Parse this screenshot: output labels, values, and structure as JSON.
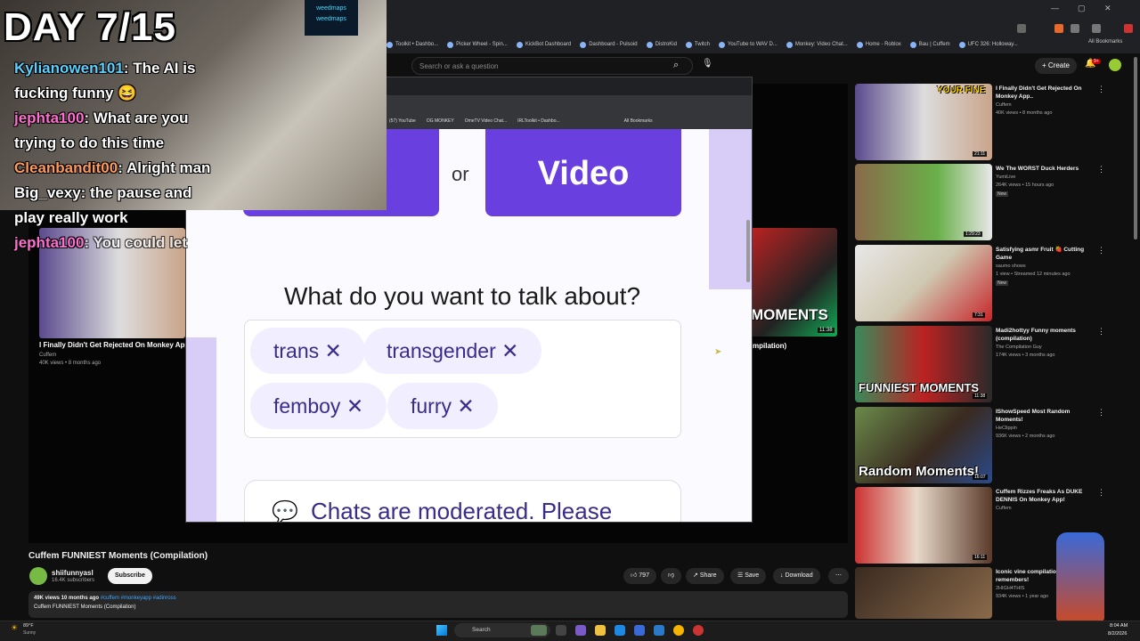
{
  "outer_browser": {
    "bookmarks": [
      "Toolkit • Dashbo...",
      "Picker Wheel - Spin...",
      "KickBot Dashboard",
      "Dashboard - Pulsoid",
      "DistroKid",
      "Twitch",
      "YouTube to WAV D...",
      "Monkey: Video Chat...",
      "Home - Roblox",
      "Bau | Cuffem",
      "UFC 326: Holloway..."
    ],
    "all_bookmarks": "All Bookmarks",
    "youtube": {
      "search_placeholder": "Search or ask a question",
      "create_label": "Create",
      "bell_badge": "9+"
    }
  },
  "overlay": {
    "day_label": "DAY 7/15",
    "neon_sign": "weedmaps",
    "chat": [
      {
        "user": "Kylianowen101",
        "message": ": The AI is"
      },
      {
        "user": "",
        "message": "fucking funny 😆"
      },
      {
        "user": "jephta100",
        "message": ": What are you"
      },
      {
        "user": "",
        "message": "trying to do this time"
      },
      {
        "user": "Cleanbandit00",
        "message": ": Alright man"
      },
      {
        "user": "",
        "message": "Big_vexy: the pause and"
      },
      {
        "user": "",
        "message": "play really work"
      },
      {
        "user": "jephta100",
        "message": ": You could let"
      }
    ]
  },
  "inner_browser": {
    "bookmarks": [
      "(57) YouTube",
      "OG MONKEY",
      "OmeTV Video Chat...",
      "IRLToolkit • Dashbo..."
    ],
    "all_bookmarks": "All Bookmarks",
    "page": {
      "or_label": "or",
      "video_button": "Video",
      "talk_title": "What do you want to talk about?",
      "tags": [
        "trans ✕",
        "transgender ✕",
        "femboy ✕",
        "furry ✕"
      ],
      "moderation_text": "Chats are moderated. Please"
    }
  },
  "background_video": {
    "title": "I Finally Didn't Get Rejected On Monkey App..",
    "channel": "Cuffem",
    "meta": "40K views • 8 months ago",
    "right_caption": "mpilation)",
    "right_overlay": "MOMENTS",
    "right_duration": "11:38"
  },
  "video": {
    "title": "Cuffem FUNNIEST Moments (Compilation)",
    "channel": "shiifunnyasl",
    "subscribers": "16.4K subscribers",
    "subscribe_label": "Subscribe",
    "likes": "797",
    "share_label": "Share",
    "save_label": "Save",
    "download_label": "Download",
    "views_line": "49K views  10 months ago",
    "hashtags": "#cuffem #monkeyapp #adinross",
    "description": "Cuffem FUNNIEST Moments (Compilation)"
  },
  "recommendations": [
    {
      "title": "I Finally Didn't Get Rejected On Monkey App..",
      "channel": "Cuffem",
      "meta": "40K views • 8 months ago",
      "duration": "21:11",
      "overlay": "YOUR FINE",
      "badge": ""
    },
    {
      "title": "We The WORST Duck Herders",
      "channel": "YumiLive",
      "meta": "264K views • 15 hours ago",
      "duration": "1:29:23",
      "overlay": "",
      "badge": "New"
    },
    {
      "title": "Satisfying asmr Fruit 🍓 Cutting Game",
      "channel": "saumo shows",
      "meta": "1 view • Streamed 12 minutes ago",
      "duration": "7:31",
      "overlay": "",
      "badge": "New"
    },
    {
      "title": "Madi2hottyy Funny moments (compilation)",
      "channel": "The Compilation Guy",
      "meta": "174K views • 3 months ago",
      "duration": "11:38",
      "overlay": "FUNNIEST MOMENTS",
      "badge": ""
    },
    {
      "title": "IShowSpeed Most Random Moments!",
      "channel": "HeClippin",
      "meta": "936K views • 2 months ago",
      "duration": "16:07",
      "overlay": "Random Moments!",
      "badge": ""
    },
    {
      "title": "Cuffem Rizzes Freaks As DUKE DENNIS On Monkey App!",
      "channel": "Cuffem",
      "meta": "",
      "duration": "16:11",
      "overlay": "",
      "badge": ""
    },
    {
      "title": "Iconic vine compilatio... remembers!",
      "channel": "2HIGH4THIS",
      "meta": "934K views • 1 year ago",
      "duration": "",
      "overlay": "",
      "badge": ""
    }
  ],
  "taskbar": {
    "temperature": "89°F",
    "condition": "Sunny",
    "search_placeholder": "Search",
    "time": "8:04 AM",
    "date": "8/2/2026"
  },
  "colors": {
    "accent_purple": "#6a3fe0",
    "tag_bg": "#f1efff",
    "youtube_bg": "#0f0f0f"
  }
}
